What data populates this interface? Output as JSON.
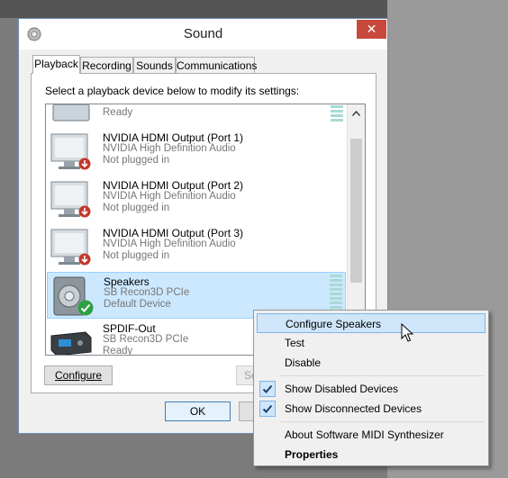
{
  "window": {
    "title": "Sound",
    "close_glyph": "✕",
    "tabs": [
      {
        "label": "Playback",
        "active": true
      },
      {
        "label": "Recording"
      },
      {
        "label": "Sounds"
      },
      {
        "label": "Communications"
      }
    ],
    "instruction": "Select a playback device below to modify its settings:"
  },
  "devices": [
    {
      "name": "",
      "driver": "",
      "status": "Ready",
      "icon": "speaker-device-icon",
      "meter_bars": 0
    },
    {
      "name": "NVIDIA HDMI Output (Port 1)",
      "driver": "NVIDIA High Definition Audio",
      "status": "Not plugged in",
      "icon": "monitor-icon",
      "badge": "unplugged-arrow-icon"
    },
    {
      "name": "NVIDIA HDMI Output (Port 2)",
      "driver": "NVIDIA High Definition Audio",
      "status": "Not plugged in",
      "icon": "monitor-icon",
      "badge": "unplugged-arrow-icon"
    },
    {
      "name": "NVIDIA HDMI Output (Port 3)",
      "driver": "NVIDIA High Definition Audio",
      "status": "Not plugged in",
      "icon": "monitor-icon",
      "badge": "unplugged-arrow-icon"
    },
    {
      "name": "Speakers",
      "driver": "SB Recon3D PCIe",
      "status": "Default Device",
      "icon": "speaker-icon",
      "badge": "default-check-icon",
      "selected": true,
      "meter_bars": 1
    },
    {
      "name": "SPDIF-Out",
      "driver": "SB Recon3D PCIe",
      "status": "Ready",
      "icon": "spdif-receiver-icon"
    }
  ],
  "buttons": {
    "configure": "Configure",
    "set_default": "Set Def",
    "ok": "OK"
  },
  "context_menu": {
    "items": [
      {
        "label": "Configure Speakers",
        "hover": true
      },
      {
        "label": "Test"
      },
      {
        "label": "Disable"
      },
      {
        "label": "Show Disabled Devices",
        "checked": true
      },
      {
        "label": "Show Disconnected Devices",
        "checked": true
      },
      {
        "label": "About Software MIDI Synthesizer"
      },
      {
        "label": "Properties",
        "bold": true
      }
    ]
  },
  "colors": {
    "selection": "#cce8ff",
    "close_button": "#c7493d",
    "meter_active": "#2bb24c",
    "meter_idle": "#a9dad4",
    "menu_hover": "#cfe6fa"
  }
}
